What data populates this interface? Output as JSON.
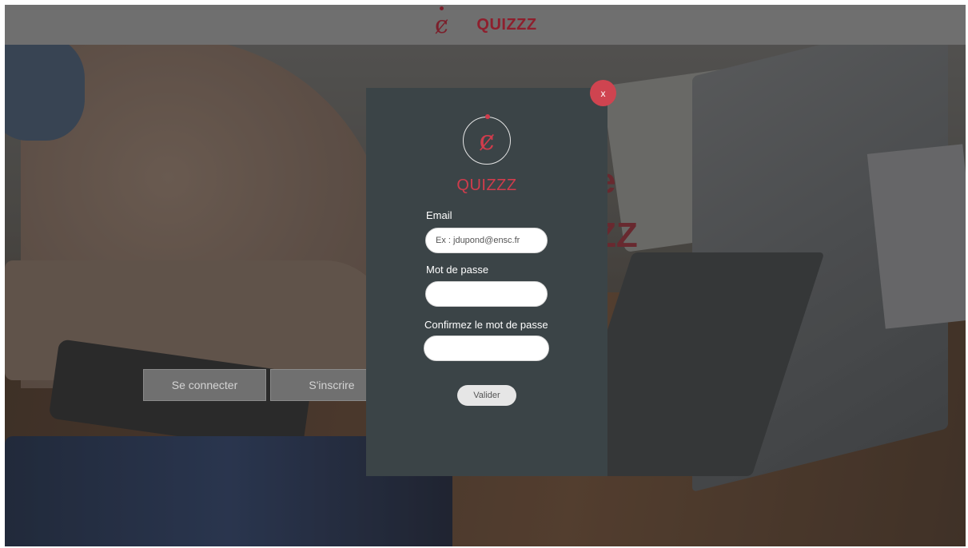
{
  "app": {
    "brand": "QUIZZZ",
    "logo_glyph": "ȼ"
  },
  "background": {
    "buttons": {
      "login": "Se connecter",
      "signup": "S'inscrire"
    },
    "partial_heading_1": "e",
    "partial_heading_2": "ZZ"
  },
  "modal": {
    "close_label": "x",
    "brand": "QUIZZZ",
    "logo_glyph": "ȼ",
    "fields": {
      "email": {
        "label": "Email",
        "value": "",
        "placeholder": "Ex : jdupond@ensc.fr"
      },
      "password": {
        "label": "Mot de passe",
        "value": "",
        "placeholder": ""
      },
      "confirm": {
        "label": "Confirmez le mot de passe",
        "value": "",
        "placeholder": ""
      }
    },
    "submit_label": "Valider"
  },
  "colors": {
    "accent": "#d03c4c",
    "modal_bg": "#3b4447",
    "topbar_bg": "#6f6f6f",
    "brand_dark": "#8e1f2d"
  }
}
